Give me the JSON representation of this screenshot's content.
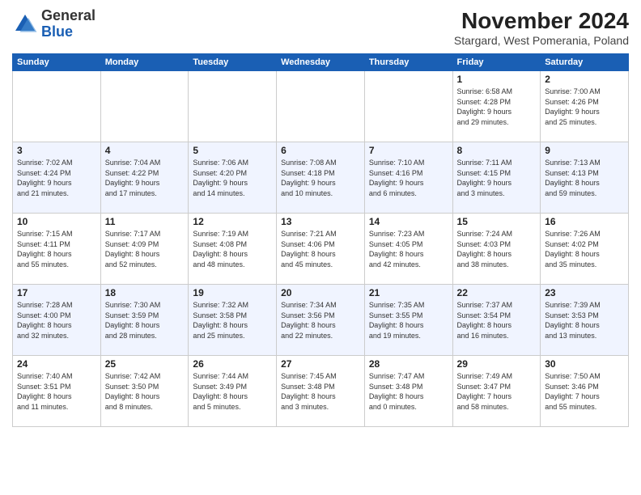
{
  "logo": {
    "general": "General",
    "blue": "Blue"
  },
  "header": {
    "month": "November 2024",
    "location": "Stargard, West Pomerania, Poland"
  },
  "weekdays": [
    "Sunday",
    "Monday",
    "Tuesday",
    "Wednesday",
    "Thursday",
    "Friday",
    "Saturday"
  ],
  "weeks": [
    [
      {
        "day": "",
        "info": ""
      },
      {
        "day": "",
        "info": ""
      },
      {
        "day": "",
        "info": ""
      },
      {
        "day": "",
        "info": ""
      },
      {
        "day": "",
        "info": ""
      },
      {
        "day": "1",
        "info": "Sunrise: 6:58 AM\nSunset: 4:28 PM\nDaylight: 9 hours\nand 29 minutes."
      },
      {
        "day": "2",
        "info": "Sunrise: 7:00 AM\nSunset: 4:26 PM\nDaylight: 9 hours\nand 25 minutes."
      }
    ],
    [
      {
        "day": "3",
        "info": "Sunrise: 7:02 AM\nSunset: 4:24 PM\nDaylight: 9 hours\nand 21 minutes."
      },
      {
        "day": "4",
        "info": "Sunrise: 7:04 AM\nSunset: 4:22 PM\nDaylight: 9 hours\nand 17 minutes."
      },
      {
        "day": "5",
        "info": "Sunrise: 7:06 AM\nSunset: 4:20 PM\nDaylight: 9 hours\nand 14 minutes."
      },
      {
        "day": "6",
        "info": "Sunrise: 7:08 AM\nSunset: 4:18 PM\nDaylight: 9 hours\nand 10 minutes."
      },
      {
        "day": "7",
        "info": "Sunrise: 7:10 AM\nSunset: 4:16 PM\nDaylight: 9 hours\nand 6 minutes."
      },
      {
        "day": "8",
        "info": "Sunrise: 7:11 AM\nSunset: 4:15 PM\nDaylight: 9 hours\nand 3 minutes."
      },
      {
        "day": "9",
        "info": "Sunrise: 7:13 AM\nSunset: 4:13 PM\nDaylight: 8 hours\nand 59 minutes."
      }
    ],
    [
      {
        "day": "10",
        "info": "Sunrise: 7:15 AM\nSunset: 4:11 PM\nDaylight: 8 hours\nand 55 minutes."
      },
      {
        "day": "11",
        "info": "Sunrise: 7:17 AM\nSunset: 4:09 PM\nDaylight: 8 hours\nand 52 minutes."
      },
      {
        "day": "12",
        "info": "Sunrise: 7:19 AM\nSunset: 4:08 PM\nDaylight: 8 hours\nand 48 minutes."
      },
      {
        "day": "13",
        "info": "Sunrise: 7:21 AM\nSunset: 4:06 PM\nDaylight: 8 hours\nand 45 minutes."
      },
      {
        "day": "14",
        "info": "Sunrise: 7:23 AM\nSunset: 4:05 PM\nDaylight: 8 hours\nand 42 minutes."
      },
      {
        "day": "15",
        "info": "Sunrise: 7:24 AM\nSunset: 4:03 PM\nDaylight: 8 hours\nand 38 minutes."
      },
      {
        "day": "16",
        "info": "Sunrise: 7:26 AM\nSunset: 4:02 PM\nDaylight: 8 hours\nand 35 minutes."
      }
    ],
    [
      {
        "day": "17",
        "info": "Sunrise: 7:28 AM\nSunset: 4:00 PM\nDaylight: 8 hours\nand 32 minutes."
      },
      {
        "day": "18",
        "info": "Sunrise: 7:30 AM\nSunset: 3:59 PM\nDaylight: 8 hours\nand 28 minutes."
      },
      {
        "day": "19",
        "info": "Sunrise: 7:32 AM\nSunset: 3:58 PM\nDaylight: 8 hours\nand 25 minutes."
      },
      {
        "day": "20",
        "info": "Sunrise: 7:34 AM\nSunset: 3:56 PM\nDaylight: 8 hours\nand 22 minutes."
      },
      {
        "day": "21",
        "info": "Sunrise: 7:35 AM\nSunset: 3:55 PM\nDaylight: 8 hours\nand 19 minutes."
      },
      {
        "day": "22",
        "info": "Sunrise: 7:37 AM\nSunset: 3:54 PM\nDaylight: 8 hours\nand 16 minutes."
      },
      {
        "day": "23",
        "info": "Sunrise: 7:39 AM\nSunset: 3:53 PM\nDaylight: 8 hours\nand 13 minutes."
      }
    ],
    [
      {
        "day": "24",
        "info": "Sunrise: 7:40 AM\nSunset: 3:51 PM\nDaylight: 8 hours\nand 11 minutes."
      },
      {
        "day": "25",
        "info": "Sunrise: 7:42 AM\nSunset: 3:50 PM\nDaylight: 8 hours\nand 8 minutes."
      },
      {
        "day": "26",
        "info": "Sunrise: 7:44 AM\nSunset: 3:49 PM\nDaylight: 8 hours\nand 5 minutes."
      },
      {
        "day": "27",
        "info": "Sunrise: 7:45 AM\nSunset: 3:48 PM\nDaylight: 8 hours\nand 3 minutes."
      },
      {
        "day": "28",
        "info": "Sunrise: 7:47 AM\nSunset: 3:48 PM\nDaylight: 8 hours\nand 0 minutes."
      },
      {
        "day": "29",
        "info": "Sunrise: 7:49 AM\nSunset: 3:47 PM\nDaylight: 7 hours\nand 58 minutes."
      },
      {
        "day": "30",
        "info": "Sunrise: 7:50 AM\nSunset: 3:46 PM\nDaylight: 7 hours\nand 55 minutes."
      }
    ]
  ]
}
